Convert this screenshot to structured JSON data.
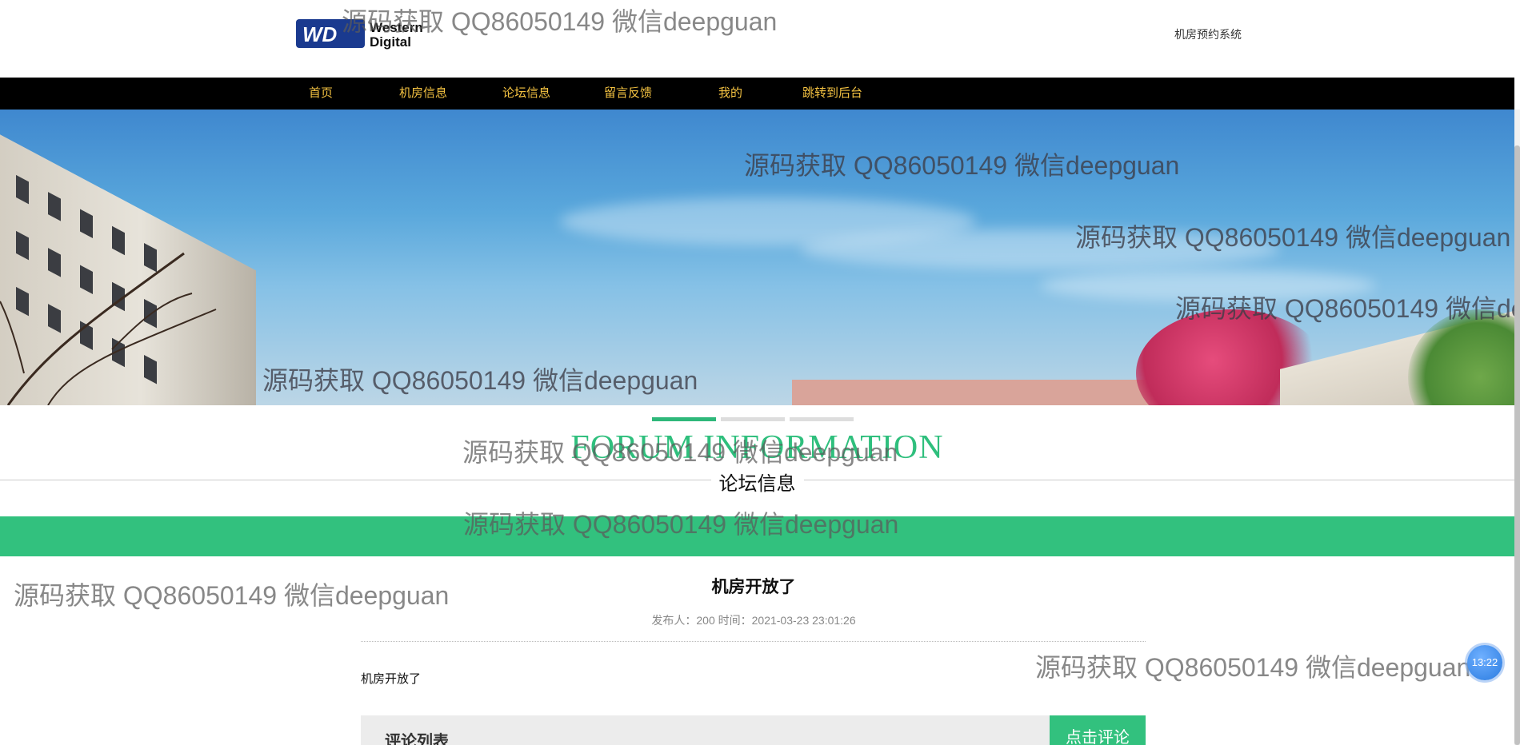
{
  "header": {
    "logo_text_line1": "Western",
    "logo_text_line2": "Digital",
    "logo_mark": "WD",
    "system_name": "机房预约系统"
  },
  "nav": {
    "items": [
      {
        "label": "首页"
      },
      {
        "label": "机房信息"
      },
      {
        "label": "论坛信息"
      },
      {
        "label": "留言反馈"
      },
      {
        "label": "我的"
      },
      {
        "label": "跳转到后台"
      }
    ]
  },
  "carousel": {
    "active_index": 0,
    "count": 3
  },
  "section": {
    "title_en": "FORUM INFORMATION",
    "title_cn": "论坛信息"
  },
  "post": {
    "title": "机房开放了",
    "meta": "发布人：200 时间：2021-03-23 23:01:26",
    "content": "机房开放了"
  },
  "comments": {
    "header": "评论列表",
    "button": "点击评论"
  },
  "clock": {
    "time": "13:22"
  },
  "watermark": {
    "text": "源码获取 QQ86050149 微信deepguan"
  },
  "colors": {
    "accent_green": "#32c17e",
    "nav_bg": "#000000",
    "nav_text": "#f5c342"
  }
}
